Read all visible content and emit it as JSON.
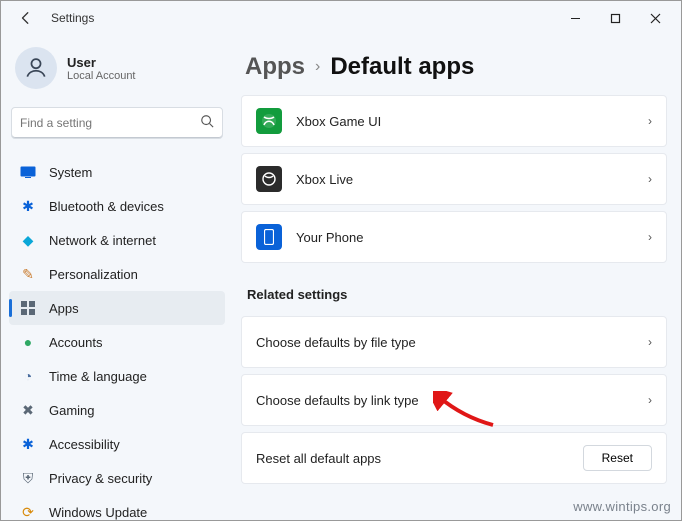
{
  "window": {
    "title": "Settings"
  },
  "user": {
    "name": "User",
    "sub": "Local Account"
  },
  "search": {
    "placeholder": "Find a setting"
  },
  "sidebar": {
    "items": [
      {
        "label": "System"
      },
      {
        "label": "Bluetooth & devices"
      },
      {
        "label": "Network & internet"
      },
      {
        "label": "Personalization"
      },
      {
        "label": "Apps"
      },
      {
        "label": "Accounts"
      },
      {
        "label": "Time & language"
      },
      {
        "label": "Gaming"
      },
      {
        "label": "Accessibility"
      },
      {
        "label": "Privacy & security"
      },
      {
        "label": "Windows Update"
      }
    ]
  },
  "breadcrumb": {
    "parent": "Apps",
    "current": "Default apps"
  },
  "apps": [
    {
      "label": "Xbox Game UI"
    },
    {
      "label": "Xbox Live"
    },
    {
      "label": "Your Phone"
    }
  ],
  "related": {
    "heading": "Related settings",
    "items": [
      {
        "label": "Choose defaults by file type"
      },
      {
        "label": "Choose defaults by link type"
      }
    ],
    "reset_label": "Reset all default apps",
    "reset_button": "Reset"
  },
  "watermark": "www.wintips.org"
}
